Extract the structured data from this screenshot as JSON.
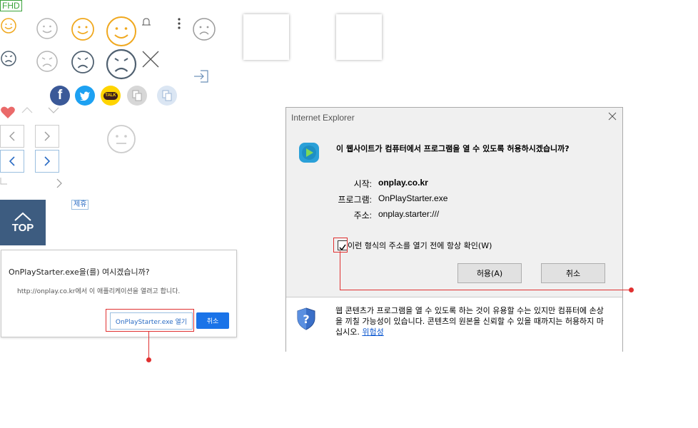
{
  "badge": {
    "fhd": "FHD"
  },
  "top_button": {
    "label": "TOP"
  },
  "link_small": {
    "label": "제휴"
  },
  "open_dialog": {
    "question": "OnPlayStarter.exe을(를) 여시겠습니까?",
    "message": "http://onplay.co.kr에서 이 애플리케이션을 열려고 합니다.",
    "open_button": "OnPlayStarter.exe 열기",
    "cancel_button": "취소"
  },
  "ie_dialog": {
    "title": "Internet Explorer",
    "heading": "이 웹사이트가 컴퓨터에서 프로그램을 열 수 있도록 허용하시겠습니까?",
    "start_label": "시작:",
    "start_value": "onplay.co.kr",
    "program_label": "프로그램:",
    "program_value": "OnPlayStarter.exe",
    "address_label": "주소:",
    "address_value": "onplay.starter:///",
    "checkbox_label": "이런 형식의 주소를 열기 전에 항상 확인(W)",
    "checkbox_checked": true,
    "allow_button": "허용(A)",
    "cancel_button": "취소",
    "warning_text": "웹 콘텐츠가 프로그램을 열 수 있도록 하는 것이 유용할 수는 있지만 컴퓨터에 손상을 끼칠 가능성이 있습니다. 콘텐츠의 원본을 신뢰할 수 있을 때까지는 허용하지 마십시오.",
    "risk_link": "위험성"
  },
  "colors": {
    "smile_yellow": "#f0a81e",
    "face_gray": "#b5b5b5",
    "face_dark": "#4f6070",
    "top_bg": "#3d5c80",
    "highlight_red": "#e03030",
    "primary_blue": "#1a73e8"
  },
  "social_icons": [
    "facebook-icon",
    "twitter-icon",
    "kakaotalk-icon",
    "copy-icon",
    "copy-icon-light"
  ],
  "social_text": {
    "facebook": "f",
    "kakao": "TALK"
  }
}
